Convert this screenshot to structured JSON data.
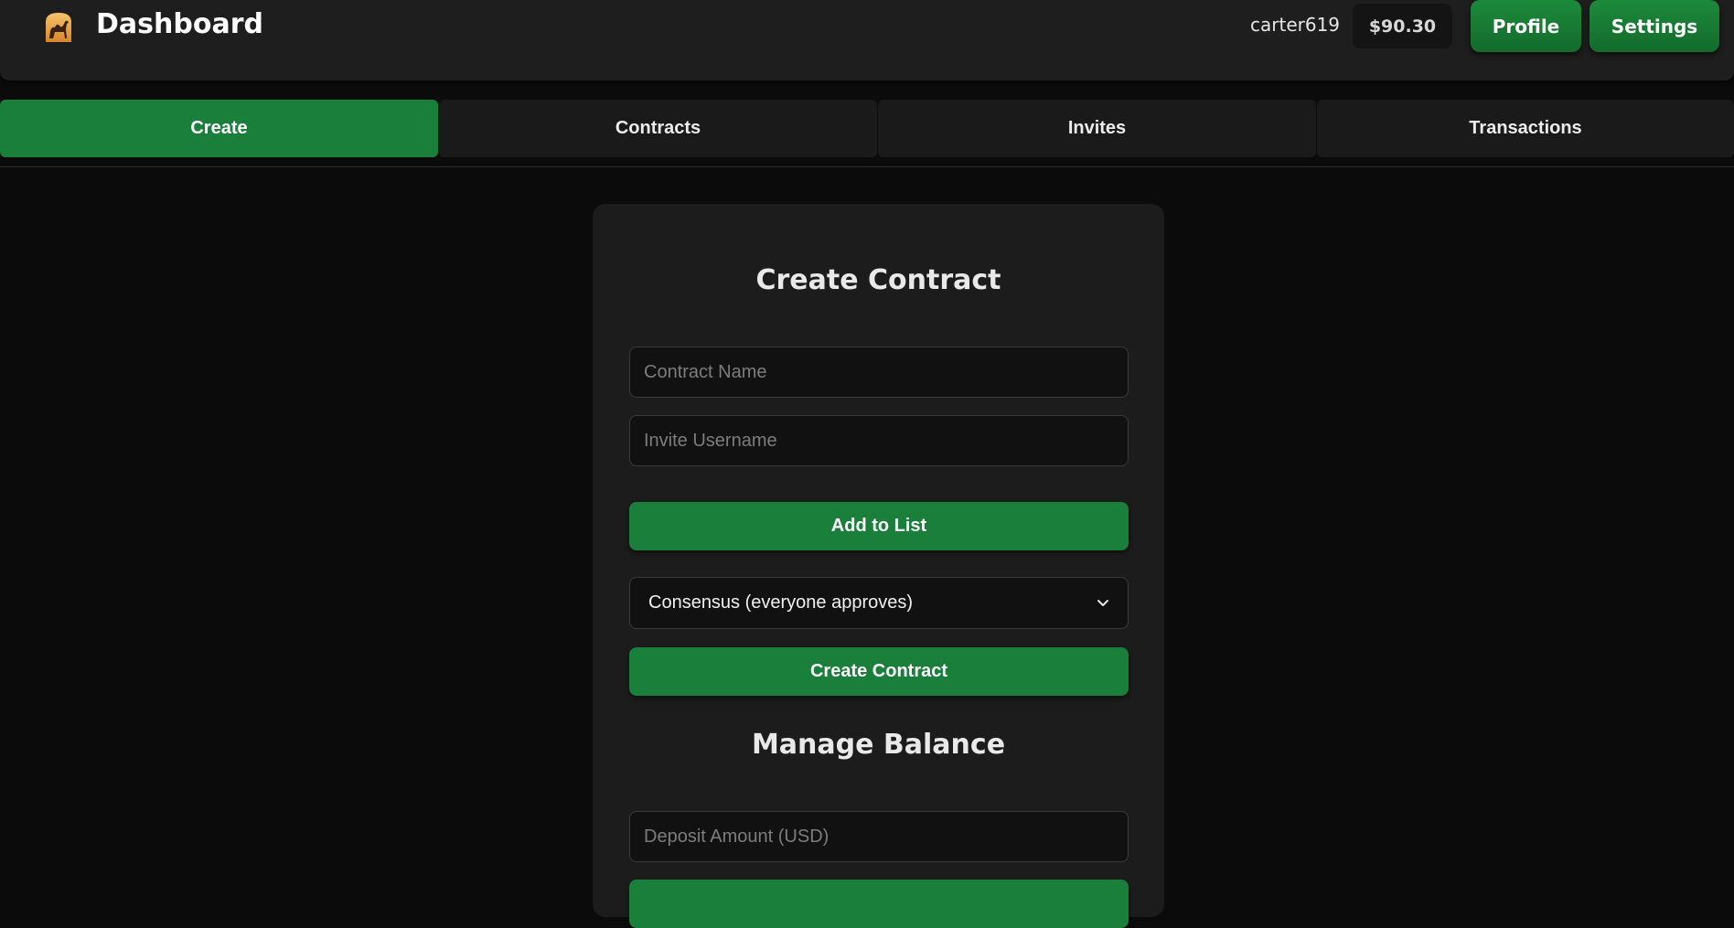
{
  "header": {
    "title": "Dashboard",
    "logo_icon": "camel-logo-icon",
    "username": "carter619",
    "balance": "$90.30",
    "profile_label": "Profile",
    "settings_label": "Settings"
  },
  "tabs": [
    {
      "label": "Create",
      "active": true
    },
    {
      "label": "Contracts",
      "active": false
    },
    {
      "label": "Invites",
      "active": false
    },
    {
      "label": "Transactions",
      "active": false
    }
  ],
  "create_contract": {
    "title": "Create Contract",
    "contract_name": {
      "placeholder": "Contract Name",
      "value": ""
    },
    "invite_username": {
      "placeholder": "Invite Username",
      "value": ""
    },
    "add_button": "Add to List",
    "approval_select": {
      "selected": "Consensus (everyone approves)"
    },
    "create_button": "Create Contract"
  },
  "manage_balance": {
    "title": "Manage Balance",
    "deposit_amount": {
      "placeholder": "Deposit Amount (USD)",
      "value": ""
    }
  },
  "colors": {
    "accent": "#1a7f3a",
    "background": "#0b0b0b",
    "surface": "#1c1c1c"
  }
}
